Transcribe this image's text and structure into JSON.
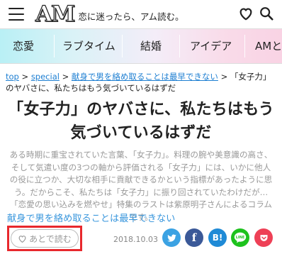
{
  "header": {
    "logo_text": "AM",
    "tagline": "恋に迷ったら、アム読む。"
  },
  "nav": {
    "categories": [
      "恋愛",
      "ラブタイム",
      "結婚",
      "アイデア",
      "AMと"
    ]
  },
  "breadcrumb": {
    "home": "top",
    "sep": ">",
    "section": "special",
    "series": "献身で男を絡め取ることは最早できない",
    "current": "「女子力」のヤバさに、私たちはもう気づいているはずだ"
  },
  "article": {
    "title_line1": "「女子力」のヤバさに、私たちはもう",
    "title_line2": "気づいているはずだ",
    "lead": "ある時期に重宝されていた言葉、「女子力」。料理の腕や美意識の高さ、そして気遣い度の3つの軸から評価される「女子力」には、いかに他人の役に立つか、大切な相手に貢献できるかという指標があったように思う。だからこそ、私たちは「女子力」に振り回されていたわけだが…「恋愛の思い込みを燃やせ」特集のラストは紫原明子さんによるコラムです。",
    "series_link": "献身で男を絡め取ることは最早できない",
    "read_later": "あとで読む",
    "date": "2018.10.03"
  },
  "share": {
    "twitter_color": "#3ba2e3",
    "facebook_color": "#3b5998",
    "hatena_color": "#1f8ad6",
    "line_color": "#1dc21d",
    "pocket_color": "#ee4056",
    "facebook_glyph": "f",
    "hatena_glyph": "B!",
    "line_glyph": "LINE"
  }
}
